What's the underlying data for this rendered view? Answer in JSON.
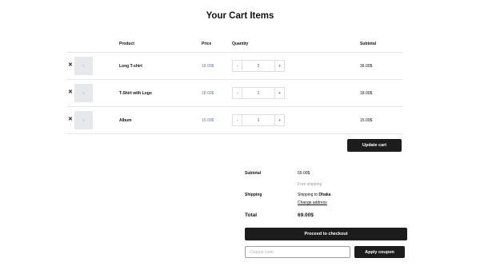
{
  "page": {
    "title": "Your Cart Items"
  },
  "table": {
    "headers": {
      "product": "Product",
      "price": "Price",
      "quantity": "Quantity",
      "subtotal": "Subtotal"
    },
    "rows": [
      {
        "name": "Long T-shirt",
        "price": "18.00$",
        "qty": "2",
        "subtotal": "36.00$"
      },
      {
        "name": "T-Shirt with Logo",
        "price": "18.00$",
        "qty": "1",
        "subtotal": "18.00$"
      },
      {
        "name": "Album",
        "price": "15.00$",
        "qty": "1",
        "subtotal": "15.00$"
      }
    ],
    "remove_symbol": "✕",
    "thumb_symbol": "≡",
    "minus_symbol": "-",
    "plus_symbol": "+"
  },
  "actions": {
    "update_cart": "Update cart"
  },
  "totals": {
    "subtotal_label": "Subtotal",
    "subtotal_value": "69.00$",
    "free_shipping": "Free shipping",
    "shipping_label": "Shipping",
    "shipping_to_prefix": "Shipping to",
    "shipping_to_city": "Dhaka",
    "change_address": "Change address",
    "total_label": "Total",
    "total_value": "69.00$"
  },
  "checkout": {
    "proceed_label": "Proceed to checkout"
  },
  "coupon": {
    "placeholder": "Coupon code",
    "apply_label": "Apply coupon"
  },
  "colors": {
    "button_dark": "#1c1c1c",
    "price_text": "#6b7a99",
    "thumb_bg": "#e7e8ec"
  }
}
